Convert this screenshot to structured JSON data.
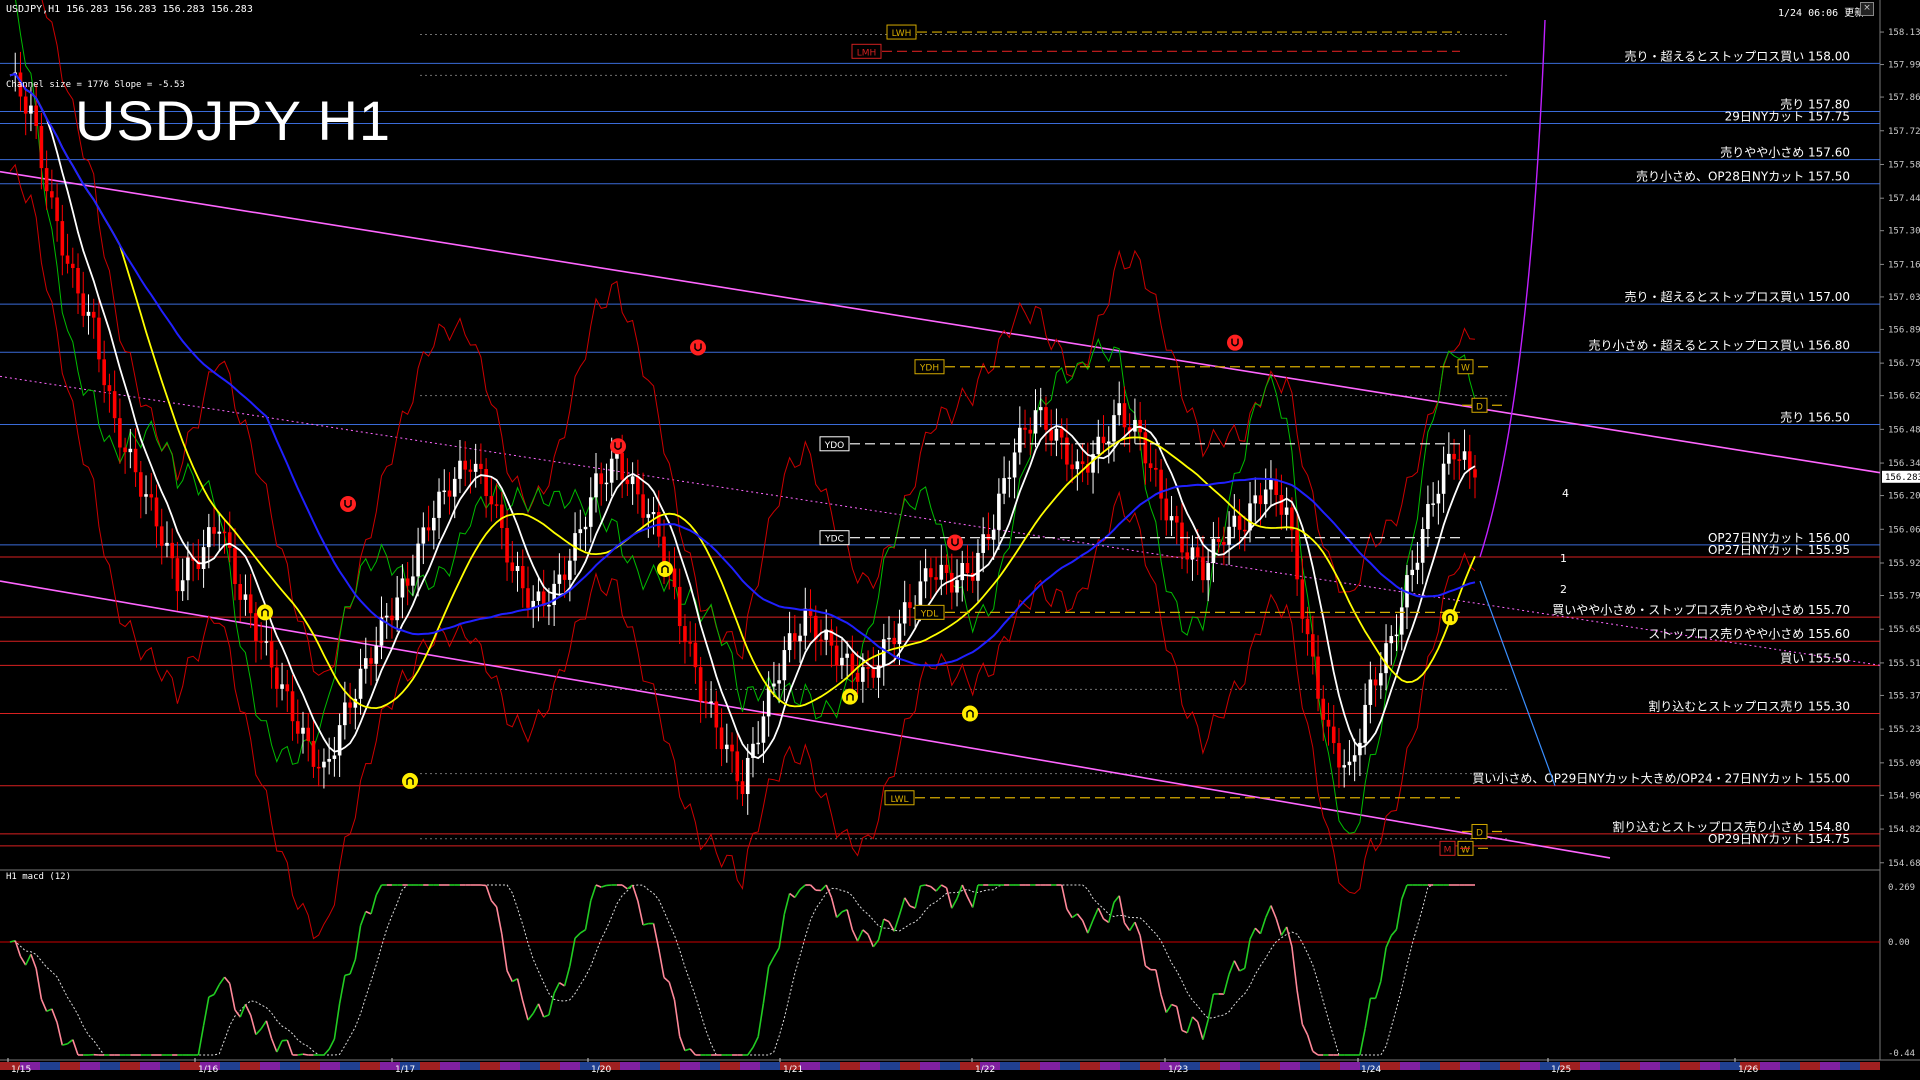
{
  "header": {
    "symbol_info": "USDJPY,H1  156.283 156.283 156.283 156.283",
    "updated": "1/24 06:06 更新"
  },
  "title": "USDJPY H1",
  "channel_info": "Channel size = 1776 Slope = -5.53",
  "macd_title": "H1  macd (12)",
  "colors": {
    "background": "#000000",
    "bull": "#ffffff",
    "bear": "#ff0000",
    "kumo_sell": "#b01818",
    "kumo_buy": "#2a4fff",
    "ma_fast": "#ffffff",
    "ma_mid": "#ffff00",
    "ma_slow": "#2020ff",
    "channel": "#ff66ff",
    "band_red": "#cc0000",
    "band_green": "#00bb00",
    "macd_up": "#22cc22",
    "macd_down": "#ff8899",
    "level_sell": "#3a6bd8",
    "level_buy": "#d82020",
    "fractal": "#ffee00",
    "fractal_down": "#ff2020"
  },
  "chart_data": {
    "type": "candlestick",
    "symbol": "USDJPY",
    "timeframe": "H1",
    "last_price": "156.283",
    "price_axis_ticks": [
      "158.130",
      "157.995",
      "157.860",
      "157.720",
      "157.580",
      "157.440",
      "157.305",
      "157.165",
      "157.030",
      "156.895",
      "156.755",
      "156.620",
      "156.480",
      "156.340",
      "156.205",
      "156.065",
      "155.925",
      "155.790",
      "155.650",
      "155.510",
      "155.375",
      "155.235",
      "155.095",
      "154.960",
      "154.820",
      "154.680"
    ],
    "date_labels": [
      "1/15",
      "1/16",
      "1/17",
      "1/20",
      "1/21",
      "1/22",
      "1/23",
      "1/24",
      "1/25",
      "1/26"
    ],
    "levels": [
      {
        "label": "売り・超えるとストップロス買い 158.00",
        "price": 158.0,
        "kind": "sell"
      },
      {
        "label": "売り 157.80",
        "price": 157.8,
        "kind": "sell"
      },
      {
        "label": "29日NYカット 157.75",
        "price": 157.75,
        "kind": "sell"
      },
      {
        "label": "売りやや小さめ 157.60",
        "price": 157.6,
        "kind": "sell"
      },
      {
        "label": "売り小さめ、OP28日NYカット 157.50",
        "price": 157.5,
        "kind": "sell"
      },
      {
        "label": "売り・超えるとストップロス買い 157.00",
        "price": 157.0,
        "kind": "sell"
      },
      {
        "label": "売り小さめ・超えるとストップロス買い 156.80",
        "price": 156.8,
        "kind": "sell"
      },
      {
        "label": "売り 156.50",
        "price": 156.5,
        "kind": "sell"
      },
      {
        "label": "OP27日NYカット 156.00",
        "price": 156.0,
        "kind": "sell"
      },
      {
        "label": "OP27日NYカット 155.95",
        "price": 155.95,
        "kind": "buy"
      },
      {
        "label": "買いやや小さめ・ストップロス売りやや小さめ 155.70",
        "price": 155.7,
        "kind": "buy"
      },
      {
        "label": "ストップロス売りやや小さめ 155.60",
        "price": 155.6,
        "kind": "buy"
      },
      {
        "label": "買い 155.50",
        "price": 155.5,
        "kind": "buy"
      },
      {
        "label": "割り込むとストップロス売り 155.30",
        "price": 155.3,
        "kind": "buy"
      },
      {
        "label": "買い小さめ、OP29日NYカット大きめ/OP24・27日NYカット 155.00",
        "price": 155.0,
        "kind": "buy"
      },
      {
        "label": "割り込むとストップロス売り小さめ 154.80",
        "price": 154.8,
        "kind": "buy"
      },
      {
        "label": "OP29日NYカット 154.75",
        "price": 154.75,
        "kind": "buy"
      }
    ],
    "markers": [
      {
        "label": "LWH",
        "price": 158.13
      },
      {
        "label": "LMH",
        "price": 158.05
      },
      {
        "label": "YDH",
        "price": 156.74
      },
      {
        "label": "YDO",
        "price": 156.42
      },
      {
        "label": "YDC",
        "price": 156.03
      },
      {
        "label": "YDL",
        "price": 155.72
      },
      {
        "label": "LWL",
        "price": 154.95
      },
      {
        "label": "W",
        "price": 156.74
      },
      {
        "label": "D",
        "price": 156.58
      },
      {
        "label": "D",
        "price": 154.81
      },
      {
        "label": "W",
        "price": 154.74
      },
      {
        "label": "M",
        "price": 154.74
      }
    ],
    "projection_labels": [
      "4",
      "1",
      "2"
    ],
    "macd_axis": [
      "0.269",
      "0.00",
      "-0.44"
    ],
    "ohlc_points": [
      157.95,
      157.8,
      157.4,
      157.1,
      156.9,
      156.5,
      156.3,
      156.1,
      155.85,
      155.95,
      156.1,
      155.8,
      155.6,
      155.4,
      155.2,
      155.05,
      155.3,
      155.5,
      155.7,
      155.85,
      156.1,
      156.25,
      156.35,
      156.2,
      155.9,
      155.75,
      155.8,
      156.0,
      156.25,
      156.35,
      156.2,
      156.05,
      155.7,
      155.4,
      155.2,
      155.0,
      155.3,
      155.55,
      155.7,
      155.6,
      155.5,
      155.45,
      155.6,
      155.75,
      155.9,
      155.85,
      155.9,
      156.1,
      156.4,
      156.55,
      156.45,
      156.3,
      156.4,
      156.55,
      156.45,
      156.2,
      156.0,
      155.9,
      156.05,
      156.1,
      156.25,
      156.15,
      155.6,
      155.2,
      155.05,
      155.4,
      155.6,
      155.9,
      156.2,
      156.4,
      156.28
    ]
  }
}
